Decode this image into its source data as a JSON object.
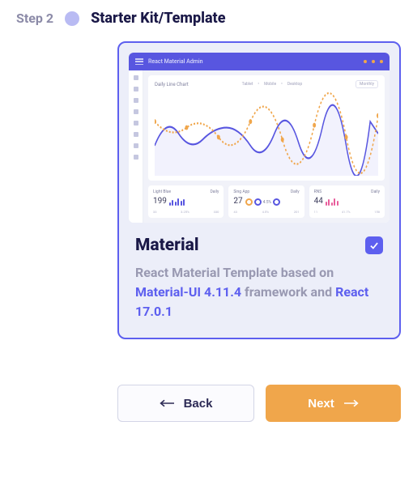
{
  "header": {
    "step_label": "Step 2",
    "title": "Starter Kit/Template"
  },
  "card": {
    "title": "Material",
    "checked": true,
    "desc_part1": "React Material Template based on ",
    "link1": "Material-UI 4.11.4",
    "desc_part2": " framework and ",
    "link2": "React 17.0.1"
  },
  "thumb": {
    "app_title": "React Material Admin",
    "chart_title": "Daily Line Chart",
    "tabs": [
      "Tablet",
      "Mobile",
      "Desktop"
    ],
    "period": "Monthly",
    "stats": [
      {
        "name": "Light Blue",
        "period": "Daily",
        "value": "199",
        "foot": [
          "33",
          "3.25%",
          "330"
        ]
      },
      {
        "name": "Sing App",
        "period": "Daily",
        "value": "27",
        "sub": "4.5%",
        "foot": [
          "43",
          "4.5%",
          "201"
        ]
      },
      {
        "name": "RNS",
        "period": "Daily",
        "value": "44",
        "foot": [
          "11",
          "41.7%",
          "158"
        ]
      }
    ]
  },
  "actions": {
    "back_label": "Back",
    "next_label": "Next"
  },
  "colors": {
    "primary": "#5d5fef",
    "accent_orange": "#f0a64b",
    "accent_pink": "#e85d9b"
  }
}
